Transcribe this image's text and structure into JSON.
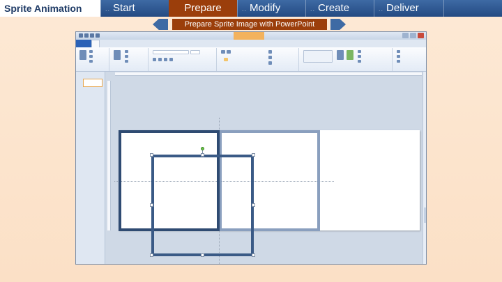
{
  "brand": "Sprite Animation",
  "nav": {
    "tabs": [
      {
        "label": "Start"
      },
      {
        "label": "Prepare"
      },
      {
        "label": "Modify"
      },
      {
        "label": "Create"
      },
      {
        "label": "Deliver"
      }
    ],
    "active": "Prepare"
  },
  "subnav": {
    "title": "Prepare Sprite Image with PowerPoint"
  },
  "colors": {
    "nav_bar": "#2f5a94",
    "active_tab": "#9b3e0b",
    "background": "#fbe3cc",
    "frame_stroke": "#2f4b72"
  },
  "icons": [
    "chevron-left-icon",
    "chevron-right-icon",
    "save-icon",
    "undo-icon",
    "redo-icon",
    "minimize-icon",
    "maximize-icon",
    "close-icon",
    "rotate-handle-icon"
  ]
}
